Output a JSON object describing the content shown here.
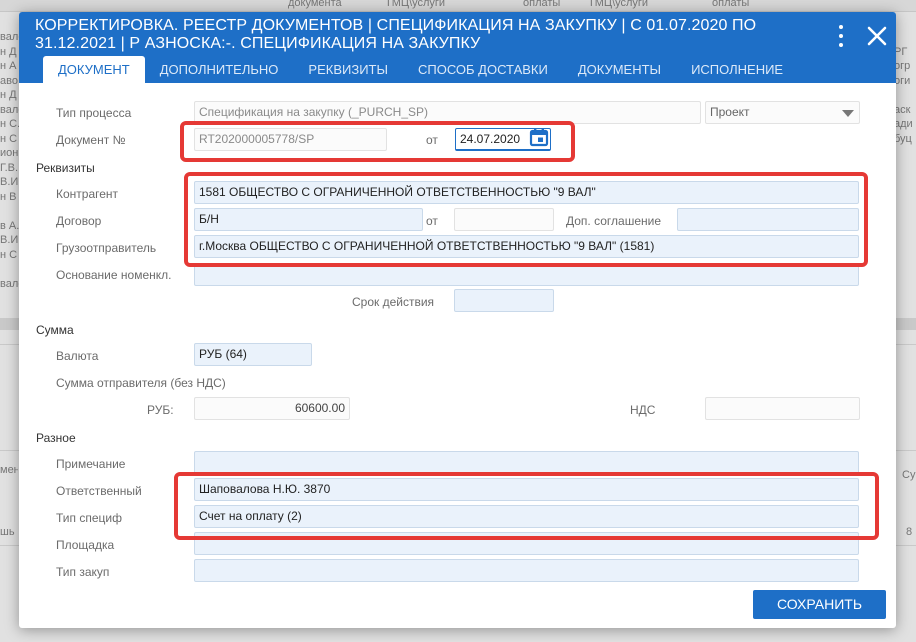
{
  "background": {
    "header_cells": [
      "документа",
      "ТМЦ\\услуги",
      "оплаты",
      "ТМЦ\\услуги",
      "оплаты"
    ],
    "left_rows": [
      "вало",
      "н Д",
      "н А",
      "аво",
      "н Д",
      "вало",
      "н С.",
      "н С",
      "ион",
      "Г.В.",
      "В.И",
      "н В",
      "",
      "в А.",
      "В.И",
      "н С",
      "",
      "вало"
    ],
    "right_rows": [
      "",
      "РГ",
      "огр",
      "оги",
      "",
      "аск",
      "ади",
      "буц"
    ],
    "left_mid": "мен",
    "left_low": "шь",
    "right_mid": "Су",
    "right_low": "8"
  },
  "dialog": {
    "title": "КОРРЕКТИРОВКА. РЕЕСТР ДОКУМЕНТОВ | СПЕЦИФИКАЦИЯ НА ЗАКУПКУ | С 01.07.2020 ПО 31.12.2021 | Р АЗНОСКА:-. СПЕЦИФИКАЦИЯ НА ЗАКУПКУ",
    "icons": {
      "menu": "more-vert-icon",
      "close": "close-icon",
      "calendar": "calendar-icon",
      "dropdown": "chevron-down-icon"
    },
    "colors": {
      "accent": "#1e6fc7",
      "highlight": "#e53935"
    },
    "tabs": [
      {
        "label": "ДОКУМЕНТ",
        "active": true
      },
      {
        "label": "ДОПОЛНИТЕЛЬНО",
        "active": false
      },
      {
        "label": "РЕКВИЗИТЫ",
        "active": false
      },
      {
        "label": "СПОСОБ ДОСТАВКИ",
        "active": false
      },
      {
        "label": "ДОКУМЕНТЫ",
        "active": false
      },
      {
        "label": "ИСПОЛНЕНИЕ",
        "active": false
      }
    ],
    "form": {
      "process_type_label": "Тип процесса",
      "process_type_value": "Спецификация на закупку (_PURCH_SP)",
      "status_value": "Проект",
      "doc_no_label": "Документ №",
      "doc_no_value": "RT202000005778/SP",
      "from_label": "от",
      "doc_date_value": "24.07.2020",
      "section_requisites": "Реквизиты",
      "counterparty_label": "Контрагент",
      "counterparty_value": "1581 ОБЩЕСТВО С ОГРАНИЧЕННОЙ ОТВЕТСТВЕННОСТЬЮ \"9 ВАЛ\"",
      "contract_label": "Договор",
      "contract_value": "Б/Н",
      "contract_from_label": "от",
      "contract_date_value": "",
      "addendum_label": "Доп. соглашение",
      "addendum_value": "",
      "shipper_label": "Грузоотправитель",
      "shipper_value": "г.Москва ОБЩЕСТВО С ОГРАНИЧЕННОЙ ОТВЕТСТВЕННОСТЬЮ \"9 ВАЛ\" (1581)",
      "nomenclature_basis_label": "Основание номенкл.",
      "nomenclature_basis_value": "",
      "validity_label": "Срок действия",
      "validity_value": "",
      "section_sum": "Сумма",
      "currency_label": "Валюта",
      "currency_value": "РУБ (64)",
      "sender_sum_label": "Сумма отправителя (без НДС)",
      "rub_label": "РУБ:",
      "rub_value": "60600.00",
      "vat_label": "НДС",
      "vat_value": "",
      "section_misc": "Разное",
      "note_label": "Примечание",
      "note_value": "",
      "responsible_label": "Ответственный",
      "responsible_value": "Шаповалова Н.Ю. 3870",
      "spec_type_label": "Тип специф",
      "spec_type_value": "Счет на оплату (2)",
      "platform_label": "Площадка",
      "platform_value": "",
      "purchase_type_label": "Тип закуп",
      "purchase_type_value": ""
    },
    "save_label": "СОХРАНИТЬ"
  }
}
